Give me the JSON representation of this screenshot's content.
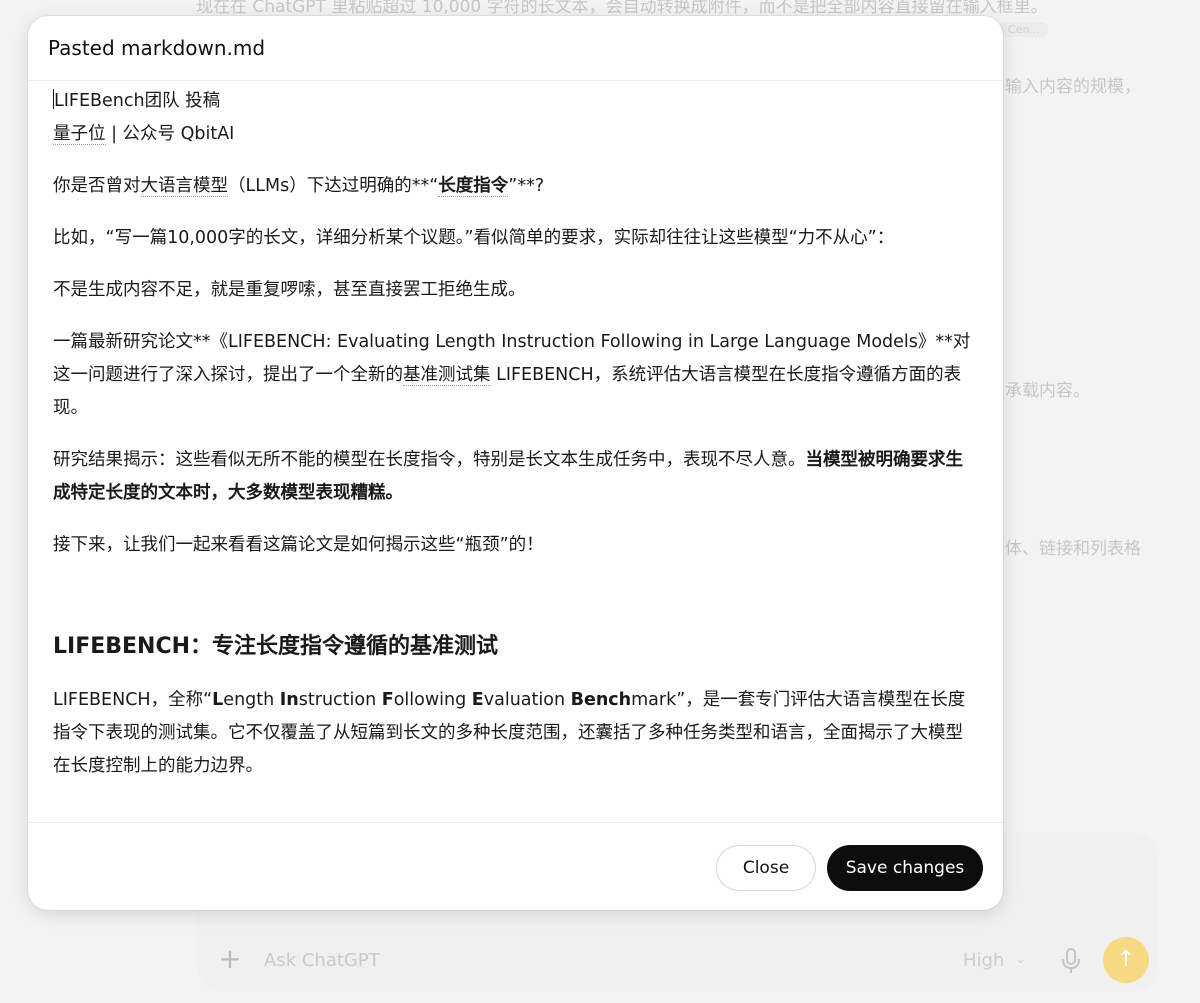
{
  "background": {
    "lines": [
      "现在在 ChatGPT 里粘贴超过 10,000 字符的长文本，会自动转换成附件，而不是把全部内容直接留在输入框里。",
      "输入内容的规模，",
      "承载内容。",
      "体、链接和列表格"
    ],
    "chip": "Cen...",
    "composer": {
      "placeholder": "Ask ChatGPT",
      "model": "High",
      "plus_icon": "+",
      "send_icon": "↑"
    }
  },
  "modal": {
    "title": "Pasted markdown.md",
    "close_label": "Close",
    "save_label": "Save changes",
    "content": {
      "p1_line1_a": "LIFEBench团队 投稿",
      "p1_line2_a": "量子位",
      "p1_line2_b": " | 公众号 QbitAI",
      "p2_a": "你是否曾对",
      "p2_link": "大语言模型",
      "p2_b": "（LLMs）下达过明确的**“",
      "p2_bold": "长度指令",
      "p2_c": "”**?",
      "p3": "比如，“写一篇10,000字的长文，详细分析某个议题。”看似简单的要求，实际却往往让这些模型“力不从心”：",
      "p4": "不是生成内容不足，就是重复啰嗦，甚至直接罢工拒绝生成。",
      "p5_a": "一篇最新研究论文**《LIFEBENCH: Evaluating Length Instruction Following in Large Language Models》**对这一问题进行了深入探讨，提出了一个全新的",
      "p5_link": "基准测试集",
      "p5_b": " LIFEBENCH，系统评估大语言模型在长度指令遵循方面的表现。",
      "p6_a": "研究结果揭示：这些看似无所不能的模型在长度指令，特别是长文本生成任务中，表现不尽人意。",
      "p6_bold": "当模型被明确要求生成特定长度的文本时，大多数模型表现糟糕。",
      "p7": "接下来，让我们一起来看看这篇论文是如何揭示这些“瓶颈”的！",
      "h2": "LIFEBENCH：专注长度指令遵循的基准测试",
      "p8_a": "LIFEBENCH，全称“",
      "p8_L": "L",
      "p8_ength": "ength ",
      "p8_In": "In",
      "p8_struction": "struction ",
      "p8_F": "F",
      "p8_ollowing": "ollowing ",
      "p8_E": "E",
      "p8_valuation": "valuation ",
      "p8_Bench": "Bench",
      "p8_b": "mark”，是一套专门评估大语言模型在长度指令下表现的测试集。它不仅覆盖了从短篇到长文的多种长度范围，还囊括了多种任务类型和语言，全面揭示了大模型在长度控制上的能力边界。"
    }
  }
}
